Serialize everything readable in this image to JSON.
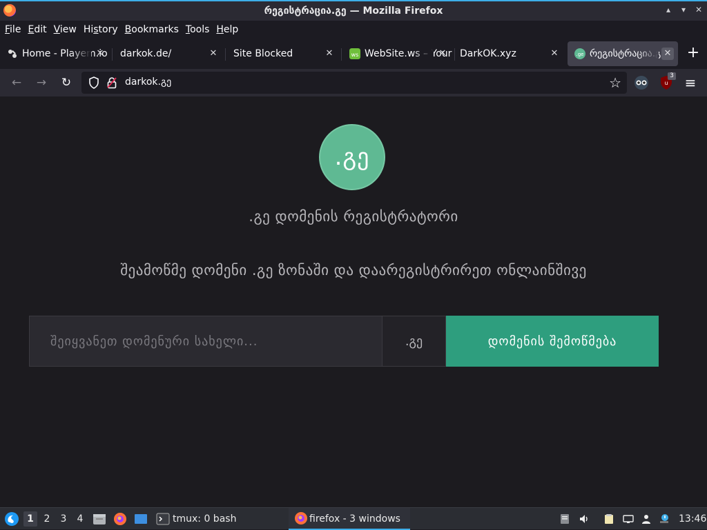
{
  "window": {
    "title": "რეგისტრაცია.გე — Mozilla Firefox",
    "controls": [
      "▴",
      "▾",
      "✕"
    ]
  },
  "menu": [
    {
      "label": "File",
      "key": "F",
      "rest": "ile"
    },
    {
      "label": "Edit",
      "key": "E",
      "rest": "dit"
    },
    {
      "label": "View",
      "key": "V",
      "rest": "iew"
    },
    {
      "label": "History",
      "key": "s",
      "pre": "Hi",
      "rest": "tory"
    },
    {
      "label": "Bookmarks",
      "key": "B",
      "rest": "ookmarks"
    },
    {
      "label": "Tools",
      "key": "T",
      "rest": "ools"
    },
    {
      "label": "Help",
      "key": "H",
      "rest": "elp"
    }
  ],
  "tabs": [
    {
      "label": "Home - Playem.io",
      "favicon": "playem-icon",
      "active": false
    },
    {
      "label": "darkok.de/",
      "favicon": "",
      "active": false
    },
    {
      "label": "Site Blocked",
      "favicon": "",
      "active": false
    },
    {
      "label": "WebSite.ws – Your Website",
      "favicon": "website-ws-icon",
      "active": false
    },
    {
      "label": "DarkOK.xyz",
      "favicon": "",
      "active": false
    },
    {
      "label": "რეგისტრაცია.გე",
      "favicon": "registracia-ge-icon",
      "active": true
    }
  ],
  "tab_close_glyph": "✕",
  "new_tab_glyph": "+",
  "nav": {
    "back": "←",
    "forward": "→",
    "reload": "↻",
    "url": "darkok.გე",
    "bookmark_star": "☆",
    "extension_badge": "3",
    "menu": "≡"
  },
  "page": {
    "logo_text": ".გე",
    "subtitle": ".გე დომენის რეგისტრატორი",
    "tagline": "შეამოწმე დომენი .გე ზონაში და დაარეგისტრირეთ ონლაინშივე",
    "search_placeholder": "შეიყვანეთ დომენური სახელი...",
    "tld": ".გე",
    "check_button": "დომენის შემოწმება"
  },
  "taskbar": {
    "desktops": [
      "1",
      "2",
      "3",
      "4"
    ],
    "active_desktop": "1",
    "terminal_task": "tmux: 0 bash",
    "firefox_task": "firefox - 3 windows",
    "clock": "13:46"
  },
  "colors": {
    "accent": "#3daee9",
    "logo_green": "#5fb993",
    "button_green": "#2e9e7e"
  }
}
